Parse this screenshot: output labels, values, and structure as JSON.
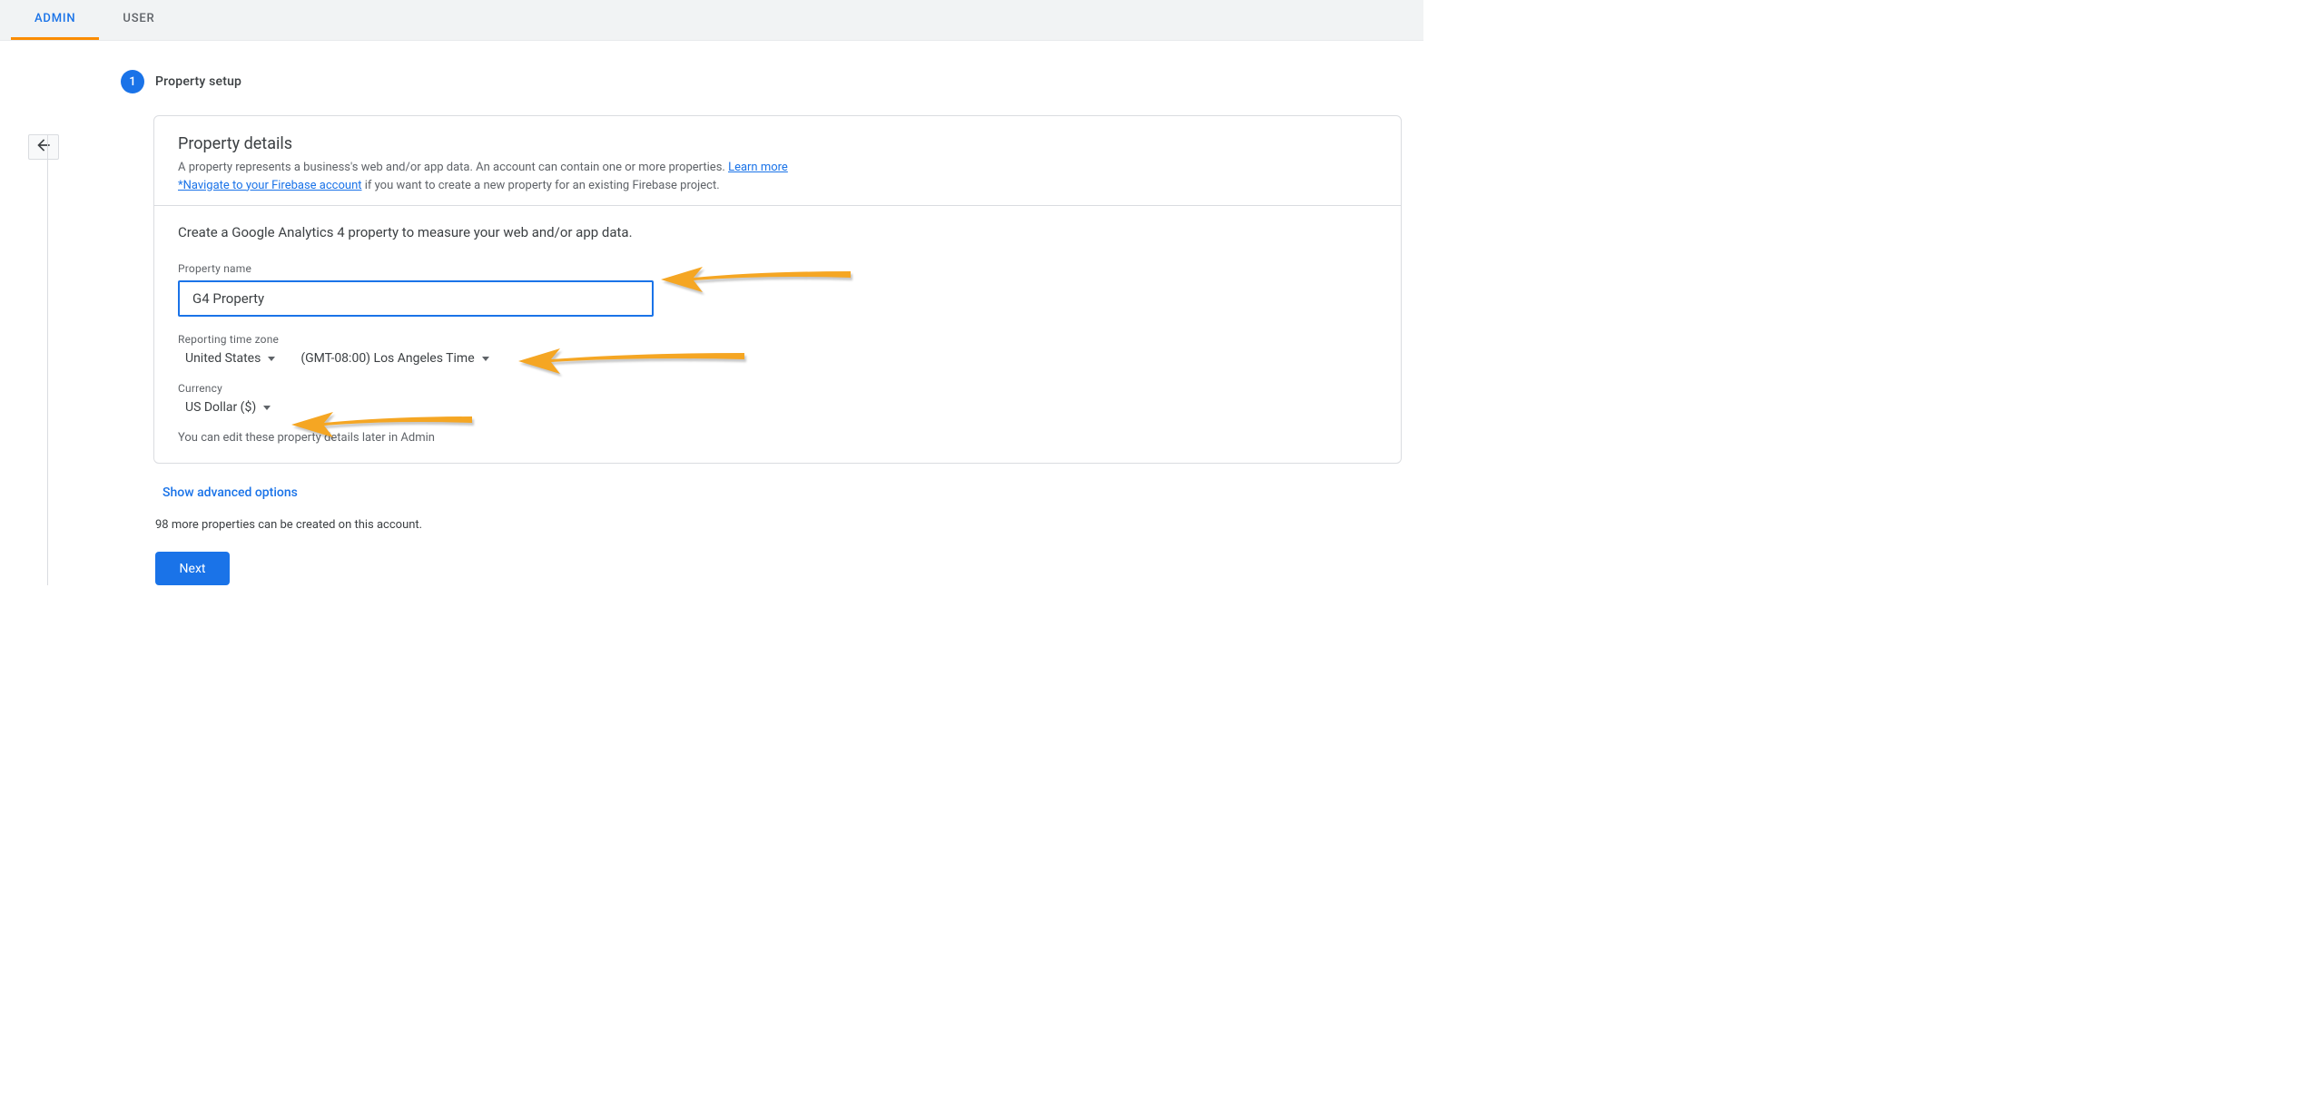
{
  "tabs": {
    "admin": "ADMIN",
    "user": "USER"
  },
  "step": {
    "number": "1",
    "title": "Property setup"
  },
  "card": {
    "section_title": "Property details",
    "desc_prefix": "A property represents a business's web and/or app data. An account can contain one or more properties. ",
    "learn_more": "Learn more",
    "firebase_link": "*Navigate to your Firebase account",
    "firebase_suffix": " if you want to create a new property for an existing Firebase project.",
    "instruction": "Create a Google Analytics 4 property to measure your web and/or app data.",
    "property_name_label": "Property name",
    "property_name_value": "G4 Property",
    "timezone_label": "Reporting time zone",
    "country_value": "United States",
    "timezone_value": "(GMT-08:00) Los Angeles Time",
    "currency_label": "Currency",
    "currency_value": "US Dollar ($)",
    "edit_hint": "You can edit these property details later in Admin"
  },
  "advanced": "Show advanced options",
  "limit": "98 more properties can be created on this account.",
  "next": "Next"
}
